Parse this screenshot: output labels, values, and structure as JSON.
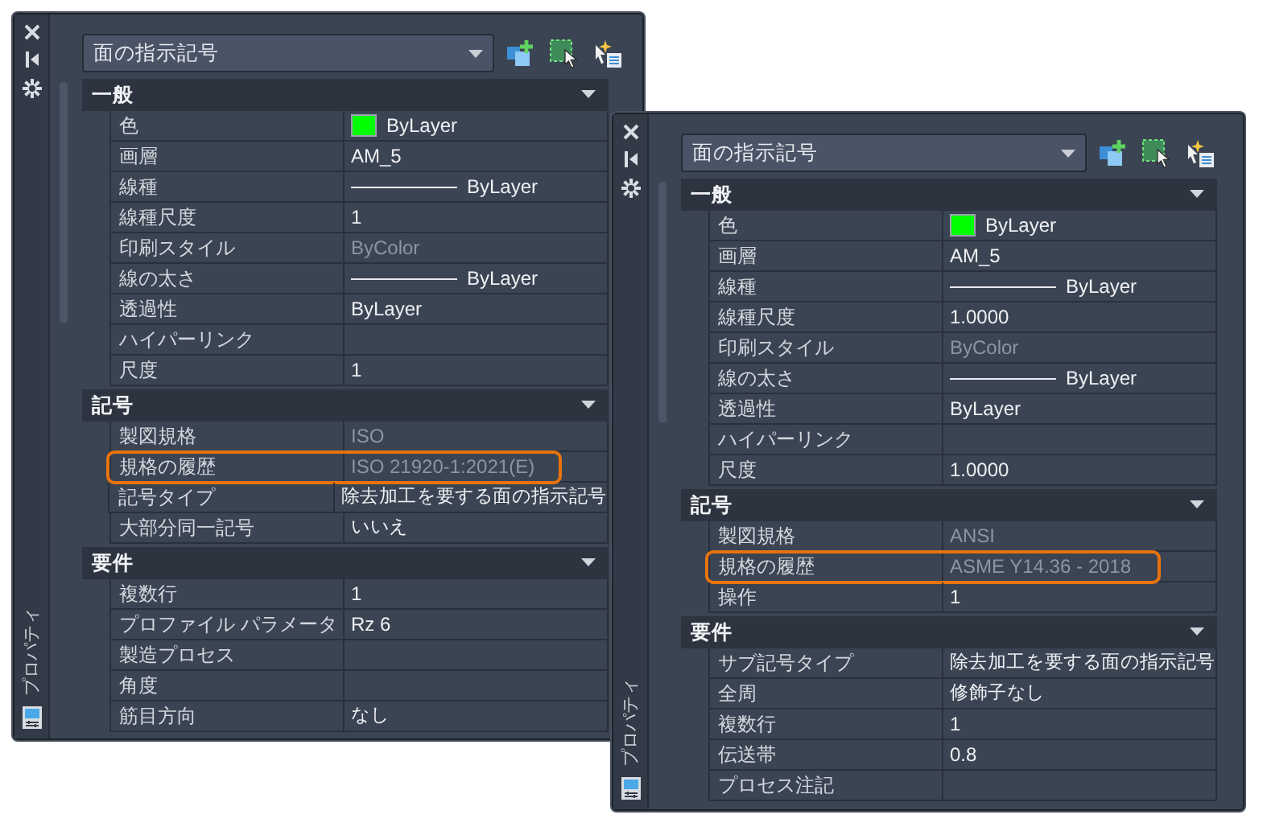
{
  "palettes": [
    {
      "title": "プロパティ",
      "selector": "面の指示記号",
      "sections": [
        {
          "title": "一般",
          "expanded": true,
          "rows": [
            {
              "name": "色",
              "value": "ByLayer",
              "kind": "color",
              "color": "#00ff00",
              "disabled": false,
              "highlighted": false
            },
            {
              "name": "画層",
              "value": "AM_5",
              "kind": "text",
              "disabled": false,
              "highlighted": false
            },
            {
              "name": "線種",
              "value": "ByLayer",
              "kind": "line",
              "disabled": false,
              "highlighted": false
            },
            {
              "name": "線種尺度",
              "value": "1",
              "kind": "text",
              "disabled": false,
              "highlighted": false
            },
            {
              "name": "印刷スタイル",
              "value": "ByColor",
              "kind": "text",
              "disabled": true,
              "highlighted": false
            },
            {
              "name": "線の太さ",
              "value": "ByLayer",
              "kind": "line",
              "disabled": false,
              "highlighted": false
            },
            {
              "name": "透過性",
              "value": "ByLayer",
              "kind": "text",
              "disabled": false,
              "highlighted": false
            },
            {
              "name": "ハイパーリンク",
              "value": "",
              "kind": "text",
              "disabled": false,
              "highlighted": false
            },
            {
              "name": "尺度",
              "value": "1",
              "kind": "text",
              "disabled": false,
              "highlighted": false
            }
          ]
        },
        {
          "title": "記号",
          "expanded": true,
          "rows": [
            {
              "name": "製図規格",
              "value": "ISO",
              "kind": "text",
              "disabled": true,
              "highlighted": false
            },
            {
              "name": "規格の履歴",
              "value": "ISO 21920-1:2021(E)",
              "kind": "text",
              "disabled": true,
              "highlighted": true
            },
            {
              "name": "記号タイプ",
              "value": "除去加工を要する面の指示記号",
              "kind": "text",
              "disabled": false,
              "highlighted": false
            },
            {
              "name": "大部分同一記号",
              "value": "いいえ",
              "kind": "text",
              "disabled": false,
              "highlighted": false
            }
          ]
        },
        {
          "title": "要件",
          "expanded": true,
          "rows": [
            {
              "name": "複数行",
              "value": "1",
              "kind": "text",
              "disabled": false,
              "highlighted": false
            },
            {
              "name": "プロファイル パラメータ",
              "value": "Rz 6",
              "kind": "text",
              "disabled": false,
              "highlighted": false
            },
            {
              "name": "製造プロセス",
              "value": "",
              "kind": "text",
              "disabled": false,
              "highlighted": false
            },
            {
              "name": "角度",
              "value": "",
              "kind": "text",
              "disabled": false,
              "highlighted": false
            },
            {
              "name": "筋目方向",
              "value": "なし",
              "kind": "text",
              "disabled": false,
              "highlighted": false
            }
          ]
        }
      ]
    },
    {
      "title": "プロパティ",
      "selector": "面の指示記号",
      "sections": [
        {
          "title": "一般",
          "expanded": true,
          "rows": [
            {
              "name": "色",
              "value": "ByLayer",
              "kind": "color",
              "color": "#00ff00",
              "disabled": false,
              "highlighted": false
            },
            {
              "name": "画層",
              "value": "AM_5",
              "kind": "text",
              "disabled": false,
              "highlighted": false
            },
            {
              "name": "線種",
              "value": "ByLayer",
              "kind": "line",
              "disabled": false,
              "highlighted": false
            },
            {
              "name": "線種尺度",
              "value": "1.0000",
              "kind": "text",
              "disabled": false,
              "highlighted": false
            },
            {
              "name": "印刷スタイル",
              "value": "ByColor",
              "kind": "text",
              "disabled": true,
              "highlighted": false
            },
            {
              "name": "線の太さ",
              "value": "ByLayer",
              "kind": "line",
              "disabled": false,
              "highlighted": false
            },
            {
              "name": "透過性",
              "value": "ByLayer",
              "kind": "text",
              "disabled": false,
              "highlighted": false
            },
            {
              "name": "ハイパーリンク",
              "value": "",
              "kind": "text",
              "disabled": false,
              "highlighted": false
            },
            {
              "name": "尺度",
              "value": "1.0000",
              "kind": "text",
              "disabled": false,
              "highlighted": false
            }
          ]
        },
        {
          "title": "記号",
          "expanded": true,
          "rows": [
            {
              "name": "製図規格",
              "value": "ANSI",
              "kind": "text",
              "disabled": true,
              "highlighted": false
            },
            {
              "name": "規格の履歴",
              "value": "ASME Y14.36 - 2018",
              "kind": "text",
              "disabled": true,
              "highlighted": true
            },
            {
              "name": "操作",
              "value": "1",
              "kind": "text",
              "disabled": false,
              "highlighted": false
            }
          ]
        },
        {
          "title": "要件",
          "expanded": true,
          "rows": [
            {
              "name": "サブ記号タイプ",
              "value": "除去加工を要する面の指示記号",
              "kind": "text",
              "disabled": false,
              "highlighted": false
            },
            {
              "name": "全周",
              "value": "修飾子なし",
              "kind": "text",
              "disabled": false,
              "highlighted": false
            },
            {
              "name": "複数行",
              "value": "1",
              "kind": "text",
              "disabled": false,
              "highlighted": false
            },
            {
              "name": "伝送帯",
              "value": "0.8",
              "kind": "text",
              "disabled": false,
              "highlighted": false
            },
            {
              "name": "プロセス注記",
              "value": "",
              "kind": "text",
              "disabled": false,
              "highlighted": false
            }
          ]
        }
      ]
    }
  ]
}
